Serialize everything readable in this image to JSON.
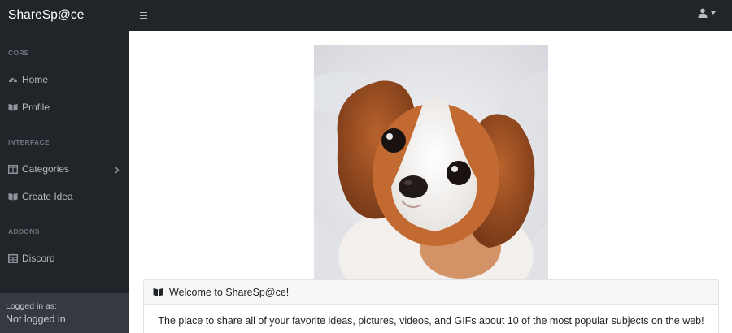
{
  "app": {
    "brand": "ShareSp@ce"
  },
  "topbar": {
    "menu_icon": "bars-icon",
    "user_icon": "user-icon"
  },
  "sidebar": {
    "sections": [
      {
        "heading": "CORE",
        "items": [
          {
            "label": "Home",
            "icon": "tachometer-icon"
          },
          {
            "label": "Profile",
            "icon": "book-open-icon"
          }
        ]
      },
      {
        "heading": "INTERFACE",
        "items": [
          {
            "label": "Categories",
            "icon": "columns-icon",
            "has_submenu": true
          },
          {
            "label": "Create Idea",
            "icon": "book-open-icon"
          }
        ]
      },
      {
        "heading": "ADDONS",
        "items": [
          {
            "label": "Discord",
            "icon": "table-icon"
          }
        ]
      }
    ],
    "footer": {
      "label": "Logged in as:",
      "status": "Not logged in"
    }
  },
  "main": {
    "hero_image": "puppy-photo",
    "card": {
      "title": "Welcome to ShareSp@ce!",
      "icon": "book-open-icon",
      "body": "The place to share all of your favorite ideas, pictures, videos, and GIFs about 10 of the most popular subjects on the web!"
    }
  },
  "colors": {
    "sidebar": "#212529",
    "footer": "#343a40",
    "card_header": "#f7f7f7"
  }
}
